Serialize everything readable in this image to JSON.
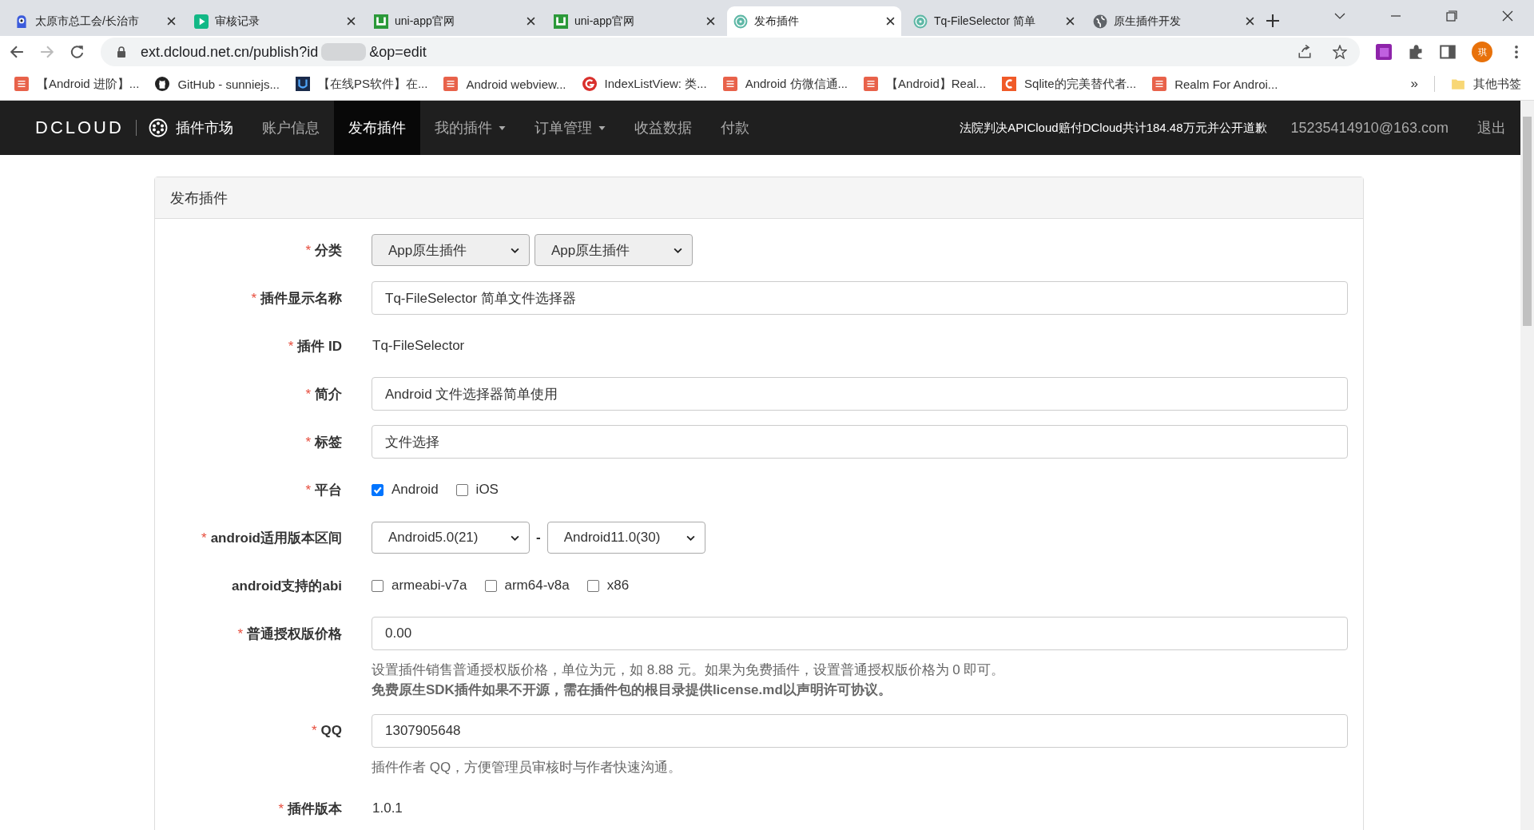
{
  "browser": {
    "tabs": [
      {
        "title": "太原市总工会/长治市",
        "kind": "mascot",
        "selected": false
      },
      {
        "title": "审核记录",
        "kind": "play",
        "selected": false
      },
      {
        "title": "uni-app官网",
        "kind": "uni",
        "selected": false
      },
      {
        "title": "uni-app官网",
        "kind": "uni",
        "selected": false
      },
      {
        "title": "发布插件",
        "kind": "dcloud",
        "selected": true
      },
      {
        "title": "Tq-FileSelector 简单",
        "kind": "dcloud",
        "selected": false
      },
      {
        "title": "原生插件开发",
        "kind": "globe",
        "selected": false
      }
    ],
    "address": {
      "before": "ext.dcloud.net.cn/publish?id",
      "after": "&op=edit"
    },
    "profile": {
      "initial": "琪"
    },
    "bookmarks": [
      {
        "title": "【Android 进阶】...",
        "kind": "square"
      },
      {
        "title": "GitHub - sunniejs...",
        "kind": "github"
      },
      {
        "title": "【在线PS软件】在...",
        "kind": "u"
      },
      {
        "title": "Android webview...",
        "kind": "square"
      },
      {
        "title": "IndexListView: 类...",
        "kind": "g"
      },
      {
        "title": "Android 仿微信通...",
        "kind": "square"
      },
      {
        "title": "【Android】Real...",
        "kind": "square"
      },
      {
        "title": "Sqlite的完美替代者...",
        "kind": "c"
      },
      {
        "title": "Realm For Androi...",
        "kind": "square"
      }
    ],
    "more_bookmarks": "»",
    "other_bookmarks": "其他书签"
  },
  "navbar": {
    "logo": "DCLOUD",
    "market": "插件市场",
    "items": [
      {
        "label": "账户信息",
        "dropdown": false,
        "selected": false
      },
      {
        "label": "发布插件",
        "dropdown": false,
        "selected": true
      },
      {
        "label": "我的插件",
        "dropdown": true,
        "selected": false
      },
      {
        "label": "订单管理",
        "dropdown": true,
        "selected": false
      },
      {
        "label": "收益数据",
        "dropdown": false,
        "selected": false
      },
      {
        "label": "付款",
        "dropdown": false,
        "selected": false
      }
    ],
    "notice": "法院判决APICloud赔付DCloud共计184.48万元并公开道歉",
    "email": "15235414910@163.com",
    "logout": "退出"
  },
  "panel": {
    "title": "发布插件",
    "rows": [
      {
        "label": "分类",
        "required_mark": "*",
        "kind": "selects",
        "selects": [
          "App原生插件",
          "App原生插件"
        ]
      },
      {
        "label": "插件显示名称",
        "required_mark": "*",
        "kind": "input",
        "value": "Tq-FileSelector 简单文件选择器"
      },
      {
        "label": "插件 ID",
        "required_mark": "*",
        "kind": "static",
        "value": "Tq-FileSelector"
      },
      {
        "label": "简介",
        "required_mark": "*",
        "kind": "input",
        "value": "Android 文件选择器简单使用"
      },
      {
        "label": "标签",
        "required_mark": "*",
        "kind": "input",
        "value": "文件选择"
      },
      {
        "label": "平台",
        "required_mark": "*",
        "kind": "checks",
        "options": [
          {
            "label": "Android",
            "checked": true
          },
          {
            "label": "iOS",
            "checked": false
          }
        ]
      },
      {
        "label": "android适用版本区间",
        "required_mark": "*",
        "kind": "range",
        "selects": [
          "Android5.0(21)",
          "Android11.0(30)"
        ],
        "separator": "-"
      },
      {
        "label": "android支持的abi",
        "kind": "checks",
        "options": [
          {
            "label": "armeabi-v7a",
            "checked": false
          },
          {
            "label": "arm64-v8a",
            "checked": false
          },
          {
            "label": "x86",
            "checked": false
          }
        ]
      },
      {
        "label": "普通授权版价格",
        "required_mark": "*",
        "kind": "input",
        "value": "0.00",
        "help": [
          {
            "text": "设置插件销售普通授权版价格，单位为元，如 8.88 元。如果为免费插件，设置普通授权版价格为 0 即可。",
            "emphasis": false
          },
          {
            "text": "免费原生SDK插件如果不开源，需在插件包的根目录提供license.md以声明许可协议。",
            "emphasis": true
          }
        ]
      },
      {
        "label": "QQ",
        "required_mark": "*",
        "kind": "input",
        "value": "1307905648",
        "help": [
          {
            "text": "插件作者 QQ，方便管理员审核时与作者快速沟通。",
            "emphasis": false
          }
        ]
      },
      {
        "label": "插件版本",
        "required_mark": "*",
        "kind": "static",
        "value": "1.0.1"
      }
    ]
  }
}
